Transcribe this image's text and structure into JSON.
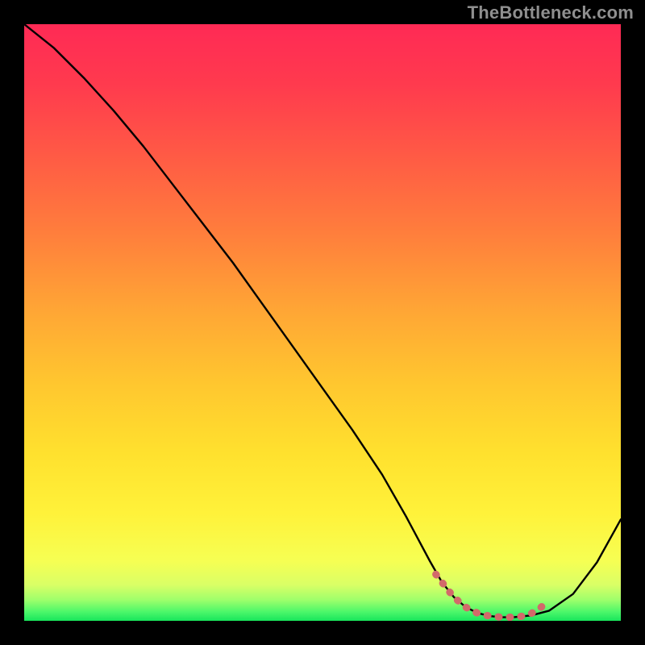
{
  "watermark": "TheBottleneck.com",
  "chart_data": {
    "type": "line",
    "title": "",
    "xlabel": "",
    "ylabel": "",
    "xlim": [
      0,
      100
    ],
    "ylim": [
      0,
      100
    ],
    "grid": false,
    "legend": false,
    "series": [
      {
        "name": "bottleneck-curve",
        "x": [
          0,
          5,
          10,
          15,
          20,
          25,
          30,
          35,
          40,
          45,
          50,
          55,
          60,
          64,
          68,
          70,
          72,
          74,
          76,
          78,
          80,
          82,
          85,
          88,
          92,
          96,
          100
        ],
        "y": [
          100,
          96,
          91,
          85.5,
          79.5,
          73,
          66.5,
          60,
          53,
          46,
          39,
          32,
          24.5,
          17.5,
          10,
          6.5,
          4,
          2.3,
          1.3,
          0.8,
          0.6,
          0.6,
          0.9,
          1.7,
          4.5,
          9.8,
          17
        ],
        "color": "#000000"
      },
      {
        "name": "low-bottleneck-band",
        "x": [
          69,
          70,
          71,
          72,
          73,
          74,
          75,
          76,
          77,
          78,
          79,
          80,
          81,
          82,
          82.5,
          83,
          83.5,
          84,
          84.5,
          85,
          85.5,
          86,
          86.5,
          87,
          87.5
        ],
        "y": [
          7.8,
          6.5,
          5.2,
          4,
          3.1,
          2.3,
          1.7,
          1.3,
          1,
          0.8,
          0.7,
          0.6,
          0.6,
          0.6,
          0.63,
          0.7,
          0.78,
          0.9,
          1.05,
          1.25,
          1.5,
          1.8,
          2.15,
          2.6,
          3.1
        ],
        "color": "#d26a6a"
      }
    ],
    "annotations": [
      {
        "text": "TheBottleneck.com",
        "position": "top-right"
      }
    ],
    "gradient_stops": [
      {
        "offset": 0.0,
        "color": "#ff2a55"
      },
      {
        "offset": 0.1,
        "color": "#ff3a4e"
      },
      {
        "offset": 0.22,
        "color": "#ff5a45"
      },
      {
        "offset": 0.35,
        "color": "#ff7e3c"
      },
      {
        "offset": 0.48,
        "color": "#ffa635"
      },
      {
        "offset": 0.6,
        "color": "#ffc62f"
      },
      {
        "offset": 0.72,
        "color": "#ffe12e"
      },
      {
        "offset": 0.82,
        "color": "#fff23a"
      },
      {
        "offset": 0.9,
        "color": "#f6ff53"
      },
      {
        "offset": 0.94,
        "color": "#d9ff66"
      },
      {
        "offset": 0.965,
        "color": "#9eff6b"
      },
      {
        "offset": 0.985,
        "color": "#4cf76a"
      },
      {
        "offset": 1.0,
        "color": "#18e55c"
      }
    ]
  }
}
